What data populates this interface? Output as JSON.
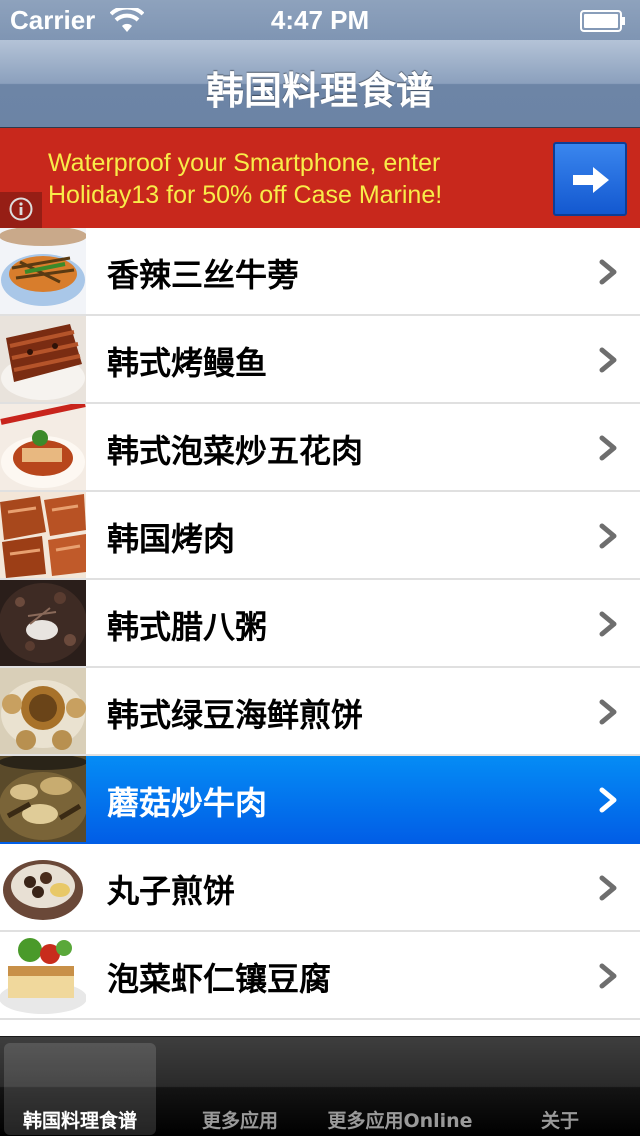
{
  "status_bar": {
    "carrier": "Carrier",
    "time": "4:47 PM"
  },
  "nav_bar": {
    "title": "韩国料理食谱"
  },
  "ad": {
    "text_line1": "Waterproof your Smartphone, enter",
    "text_line2": "Holiday13 for 50% off Case Marine!",
    "colors": {
      "background": "#c8281c",
      "text": "#f8ec49",
      "button": "#1a6ee0"
    }
  },
  "recipes": [
    {
      "label": "香辣三丝牛蒡"
    },
    {
      "label": "韩式烤鳗鱼"
    },
    {
      "label": "韩式泡菜炒五花肉"
    },
    {
      "label": "韩国烤肉"
    },
    {
      "label": "韩式腊八粥"
    },
    {
      "label": "韩式绿豆海鲜煎饼"
    },
    {
      "label": "蘑菇炒牛肉",
      "selected": true
    },
    {
      "label": "丸子煎饼"
    },
    {
      "label": "泡菜虾仁镶豆腐"
    }
  ],
  "tab_bar": {
    "tabs": [
      {
        "label": "韩国料理食谱",
        "active": true
      },
      {
        "label": "更多应用"
      },
      {
        "label": "更多应用Online"
      },
      {
        "label": "关于"
      }
    ]
  },
  "icons": {
    "wifi": "wifi-icon",
    "battery": "battery-icon",
    "ad_arrow": "arrow-right-icon",
    "ad_info": "info-icon",
    "row_chevron": "chevron-right-icon"
  },
  "colors": {
    "selected_row": "#0a74ee",
    "nav_bar": "#6d85a6",
    "tab_bar": "#1a1a1a"
  }
}
